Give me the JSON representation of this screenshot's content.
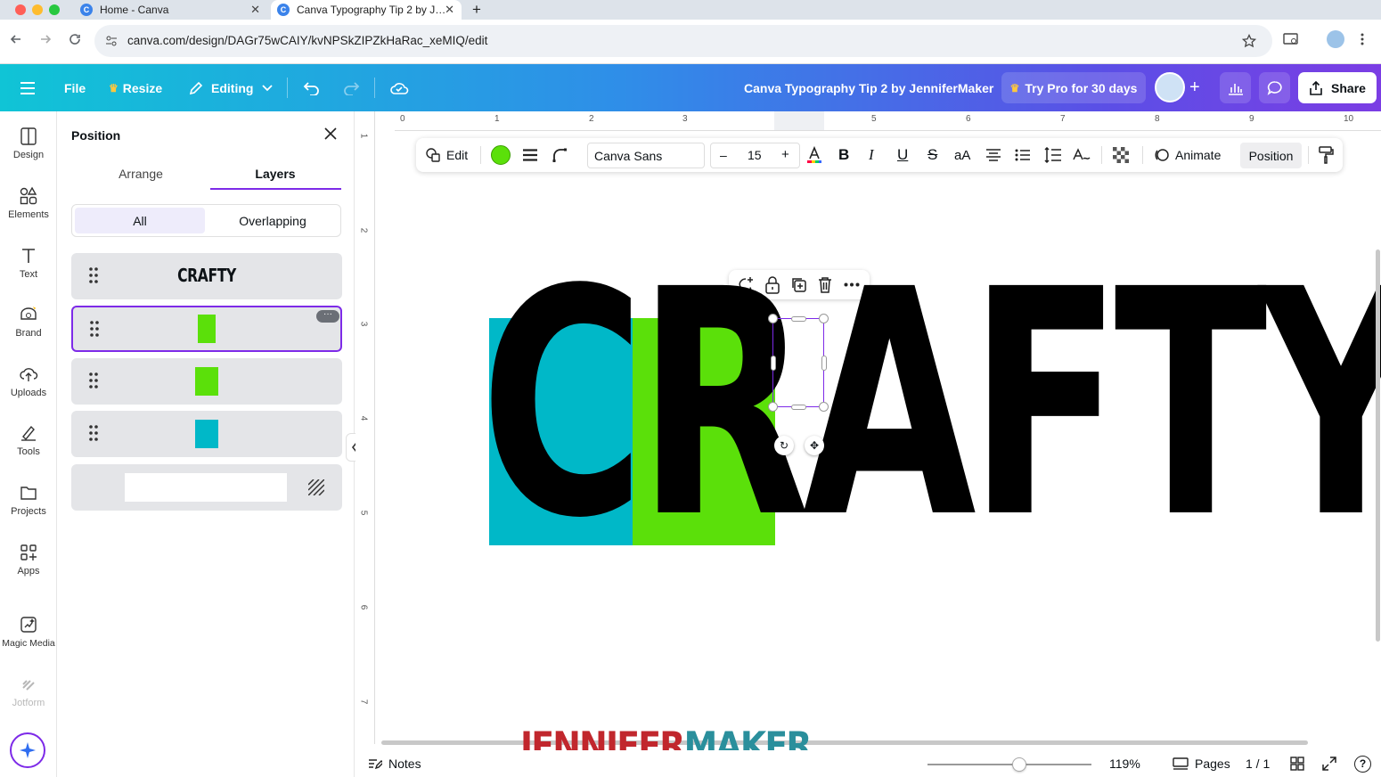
{
  "browser": {
    "tabs": [
      {
        "title": "Home - Canva",
        "close": "✕"
      },
      {
        "title": "Canva Typography Tip 2 by J…",
        "close": "✕"
      }
    ],
    "new_tab": "+",
    "url": "canva.com/design/DAGr75wCAIY/kvNPSkZIPZkHaRac_xeMIQ/edit"
  },
  "header": {
    "file": "File",
    "resize": "Resize",
    "editing": "Editing",
    "doc_title": "Canva Typography Tip 2 by JenniferMaker",
    "try_pro": "Try Pro for 30 days",
    "share": "Share"
  },
  "rail": {
    "items": [
      {
        "label": "Design",
        "icon": "design-icon"
      },
      {
        "label": "Elements",
        "icon": "elements-icon"
      },
      {
        "label": "Text",
        "icon": "text-icon"
      },
      {
        "label": "Brand",
        "icon": "brand-icon"
      },
      {
        "label": "Uploads",
        "icon": "uploads-icon"
      },
      {
        "label": "Tools",
        "icon": "tools-icon"
      },
      {
        "label": "Projects",
        "icon": "projects-icon"
      },
      {
        "label": "Apps",
        "icon": "apps-icon"
      },
      {
        "label": "Magic Media",
        "icon": "magic-media-icon"
      },
      {
        "label": "Jotform",
        "icon": "jotform-icon"
      }
    ]
  },
  "panel": {
    "title": "Position",
    "tabs": [
      "Arrange",
      "Layers"
    ],
    "active_tab": "Layers",
    "filters": [
      "All",
      "Overlapping"
    ],
    "layers": [
      {
        "label": "CRAFTY",
        "kind": "text"
      },
      {
        "kind": "shape",
        "color": "#5be00a",
        "selected": true
      },
      {
        "kind": "shape",
        "color": "#5be00a"
      },
      {
        "kind": "shape",
        "color": "#00b8c8"
      },
      {
        "kind": "background",
        "color": "#ffffff"
      }
    ],
    "more": "···"
  },
  "ruler": {
    "h": [
      "0",
      "1",
      "2",
      "3",
      "4",
      "5",
      "6",
      "7",
      "8",
      "9",
      "10"
    ],
    "v": [
      "1",
      "2",
      "3",
      "4",
      "5",
      "6",
      "7"
    ]
  },
  "toolbar": {
    "edit": "Edit",
    "color": "#5be00a",
    "font": "Canva Sans",
    "minus": "–",
    "size": "15",
    "plus": "+",
    "case": "aA",
    "animate": "Animate",
    "position": "Position"
  },
  "design": {
    "word": "CRAFTY",
    "colors": {
      "cyan": "#00b8c8",
      "green": "#5be00a",
      "text": "#000000"
    }
  },
  "footer": {
    "notes": "Notes",
    "zoom": "119%",
    "zoom_level": 0.56,
    "pages": "Pages",
    "page_count": "1 / 1",
    "help": "?"
  },
  "watermark": {
    "part1": "JENNIFER",
    "part2": "MAKER"
  },
  "accent": "#7d2ae8"
}
